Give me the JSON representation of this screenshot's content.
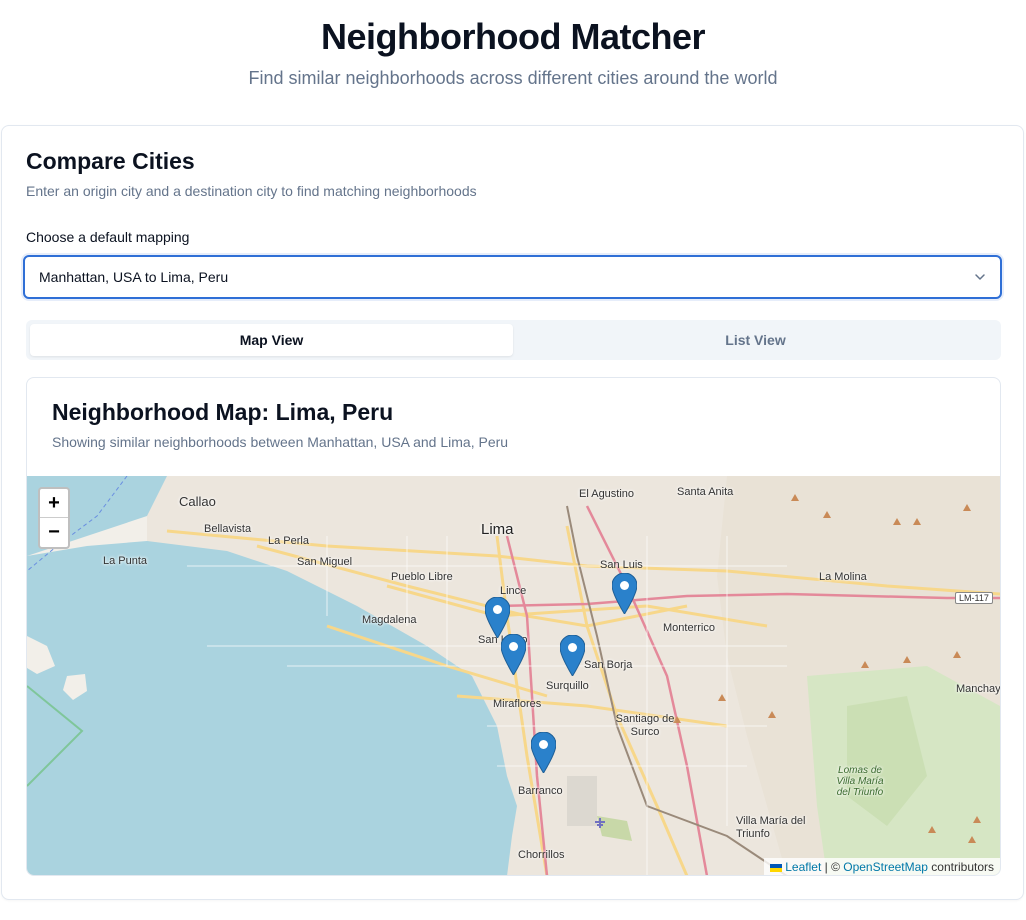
{
  "header": {
    "title": "Neighborhood Matcher",
    "subtitle": "Find similar neighborhoods across different cities around the world"
  },
  "compare": {
    "title": "Compare Cities",
    "description": "Enter an origin city and a destination city to find matching neighborhoods",
    "mapping_label": "Choose a default mapping",
    "mapping_value": "Manhattan, USA to Lima, Peru"
  },
  "tabs": [
    {
      "label": "Map View",
      "active": true
    },
    {
      "label": "List View",
      "active": false
    }
  ],
  "map_panel": {
    "title": "Neighborhood Map: Lima, Peru",
    "description": "Showing similar neighborhoods between Manhattan, USA and Lima, Peru",
    "zoom_in": "+",
    "zoom_out": "−",
    "attribution": {
      "leaflet": "Leaflet",
      "separator": " | © ",
      "osm": "OpenStreetMap",
      "suffix": " contributors"
    },
    "place_labels": {
      "callao": "Callao",
      "el_agustino": "El Agustino",
      "santa_anita": "Santa Anita",
      "bellavista": "Bellavista",
      "lima": "Lima",
      "la_perla": "La Perla",
      "la_punta": "La Punta",
      "san_miguel": "San Miguel",
      "pueblo_libre": "Pueblo Libre",
      "san_luis": "San Luis",
      "la_molina": "La Molina",
      "lince": "Lince",
      "magdalena": "Magdalena",
      "san_isidro": "San Isidro",
      "monterrico": "Monterrico",
      "san_borja": "San Borja",
      "surquillo": "Surquillo",
      "manchay": "Manchay",
      "miraflores": "Miraflores",
      "santiago_de_surco": "Santiago de Surco",
      "lomas": "Lomas de Villa María del Triunfo",
      "barranco": "Barranco",
      "villa_maria": "Villa María del Triunfo",
      "chorrillos": "Chorrillos",
      "lm117": "LM-117"
    },
    "markers": [
      "San Isidro",
      "San Isidro South",
      "San Borja",
      "San Luis",
      "Barranco"
    ],
    "colors": {
      "water": "#aad3df",
      "land": "#f2efe9",
      "marker": "#2a81cb",
      "accent": "#2f6fd6"
    }
  }
}
